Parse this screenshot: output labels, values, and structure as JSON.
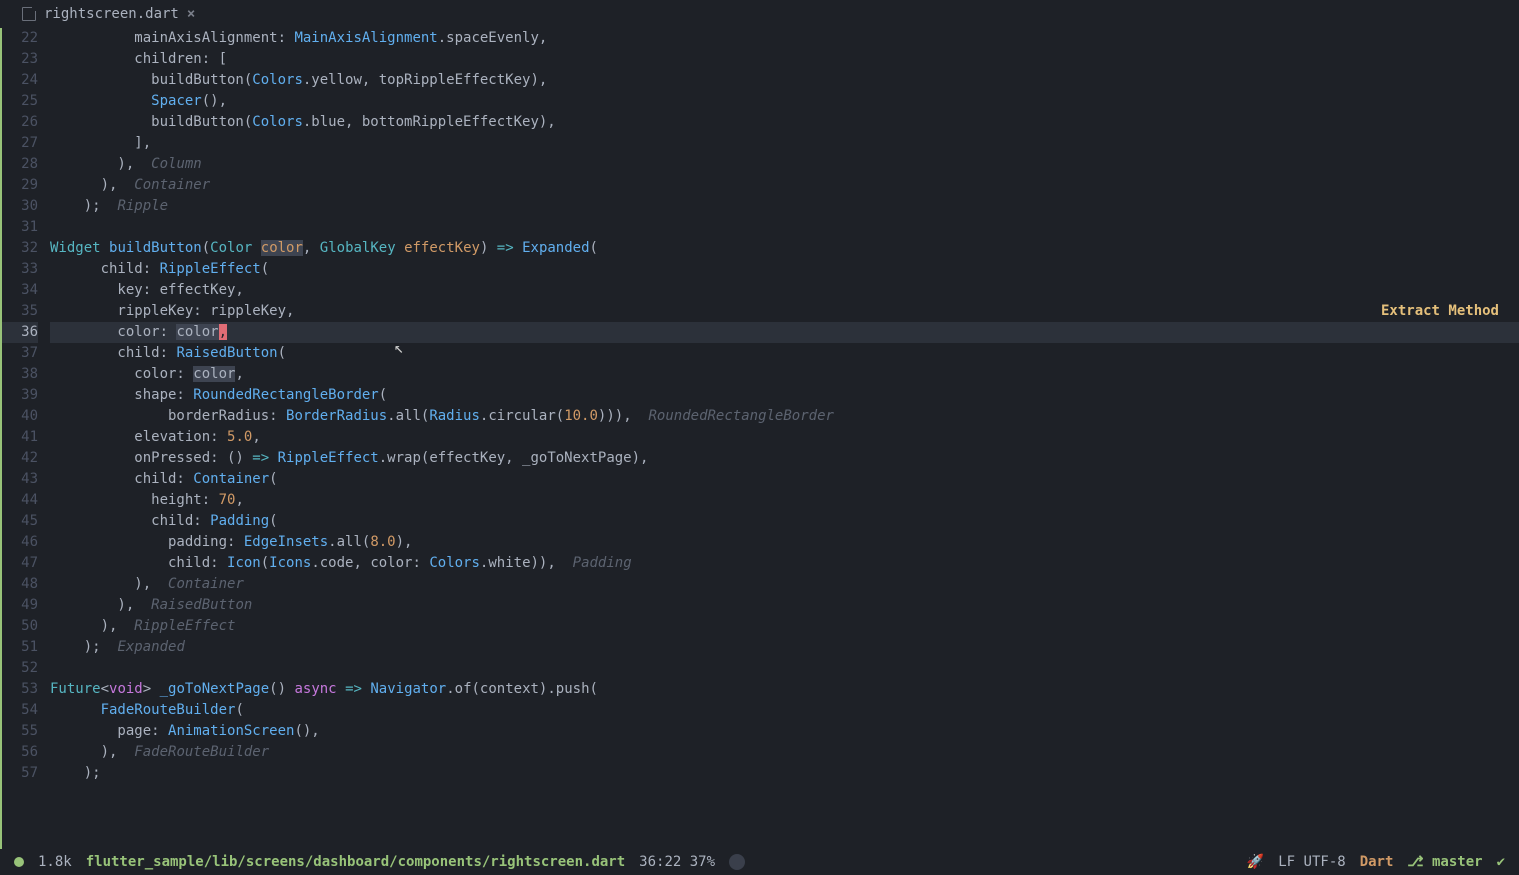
{
  "tab": {
    "filename": "rightscreen.dart",
    "close": "×"
  },
  "gutter": [
    "22",
    "23",
    "24",
    "25",
    "26",
    "27",
    "28",
    "29",
    "30",
    "31",
    "32",
    "33",
    "34",
    "35",
    "36",
    "37",
    "38",
    "39",
    "40",
    "41",
    "42",
    "43",
    "44",
    "45",
    "46",
    "47",
    "48",
    "49",
    "50",
    "51",
    "52",
    "53",
    "54",
    "55",
    "56",
    "57"
  ],
  "hint": "Extract Method",
  "code": {
    "l22a": "          mainAxisAlignment: ",
    "l22b": "MainAxisAlignment",
    "l22c": ".spaceEvenly,",
    "l23": "          children: [",
    "l24a": "            buildButton(",
    "l24b": "Colors",
    "l24c": ".yellow, topRippleEffectKey),",
    "l25a": "            ",
    "l25b": "Spacer",
    "l25c": "(),",
    "l26a": "            buildButton(",
    "l26b": "Colors",
    "l26c": ".blue, bottomRippleEffectKey),",
    "l27": "          ],",
    "l28a": "        ),  ",
    "l28b": "Column",
    "l29a": "      ),  ",
    "l29b": "Container",
    "l30a": "    );  ",
    "l30b": "Ripple",
    "l31": "",
    "l32a": "Widget",
    "l32b": " ",
    "l32c": "buildButton",
    "l32d": "(",
    "l32e": "Color",
    "l32f": " ",
    "l32g": "color",
    "l32h": ", ",
    "l32i": "GlobalKey",
    "l32j": " ",
    "l32k": "effectKey",
    "l32l": ") ",
    "l32m": "=>",
    "l32n": " ",
    "l32o": "Expanded",
    "l32p": "(",
    "l33a": "      child: ",
    "l33b": "RippleEffect",
    "l33c": "(",
    "l34": "        key: effectKey,",
    "l35": "        rippleKey: rippleKey,",
    "l36a": "        color: ",
    "l36b": "color",
    "l36c": ",",
    "l37a": "        child: ",
    "l37b": "RaisedButton",
    "l37c": "(",
    "l38a": "          color: ",
    "l38b": "color",
    "l38c": ",",
    "l39a": "          shape: ",
    "l39b": "RoundedRectangleBorder",
    "l39c": "(",
    "l40a": "              borderRadius: ",
    "l40b": "BorderRadius",
    "l40c": ".all(",
    "l40d": "Radius",
    "l40e": ".circular(",
    "l40f": "10.0",
    "l40g": "))),  ",
    "l40h": "RoundedRectangleBorder",
    "l41a": "          elevation: ",
    "l41b": "5.0",
    "l41c": ",",
    "l42a": "          onPressed: () ",
    "l42b": "=>",
    "l42c": " ",
    "l42d": "RippleEffect",
    "l42e": ".wrap(effectKey, _goToNextPage),",
    "l43a": "          child: ",
    "l43b": "Container",
    "l43c": "(",
    "l44a": "            height: ",
    "l44b": "70",
    "l44c": ",",
    "l45a": "            child: ",
    "l45b": "Padding",
    "l45c": "(",
    "l46a": "              padding: ",
    "l46b": "EdgeInsets",
    "l46c": ".all(",
    "l46d": "8.0",
    "l46e": "),",
    "l47a": "              child: ",
    "l47b": "Icon",
    "l47c": "(",
    "l47d": "Icons",
    "l47e": ".code, color: ",
    "l47f": "Colors",
    "l47g": ".white)),  ",
    "l47h": "Padding",
    "l48a": "          ),  ",
    "l48b": "Container",
    "l49a": "        ),  ",
    "l49b": "RaisedButton",
    "l50a": "      ),  ",
    "l50b": "RippleEffect",
    "l51a": "    );  ",
    "l51b": "Expanded",
    "l52": "",
    "l53a": "Future",
    "l53b": "<",
    "l53c": "void",
    "l53d": "> ",
    "l53e": "_goToNextPage",
    "l53f": "() ",
    "l53g": "async",
    "l53h": " ",
    "l53i": "=>",
    "l53j": " ",
    "l53k": "Navigator",
    "l53l": ".of(context).push(",
    "l54a": "      ",
    "l54b": "FadeRouteBuilder",
    "l54c": "(",
    "l55a": "        page: ",
    "l55b": "AnimationScreen",
    "l55c": "(),",
    "l56a": "      ),  ",
    "l56b": "FadeRouteBuilder",
    "l57": "    );"
  },
  "status": {
    "size": "1.8k",
    "path": "flutter_sample/lib/screens/dashboard/components/rightscreen.dart",
    "pos": "36:22 37%",
    "encoding": "LF UTF-8",
    "lang": "Dart",
    "branch_icon": "⎇",
    "branch": "master",
    "rocket": "🚀",
    "check": "✔"
  }
}
